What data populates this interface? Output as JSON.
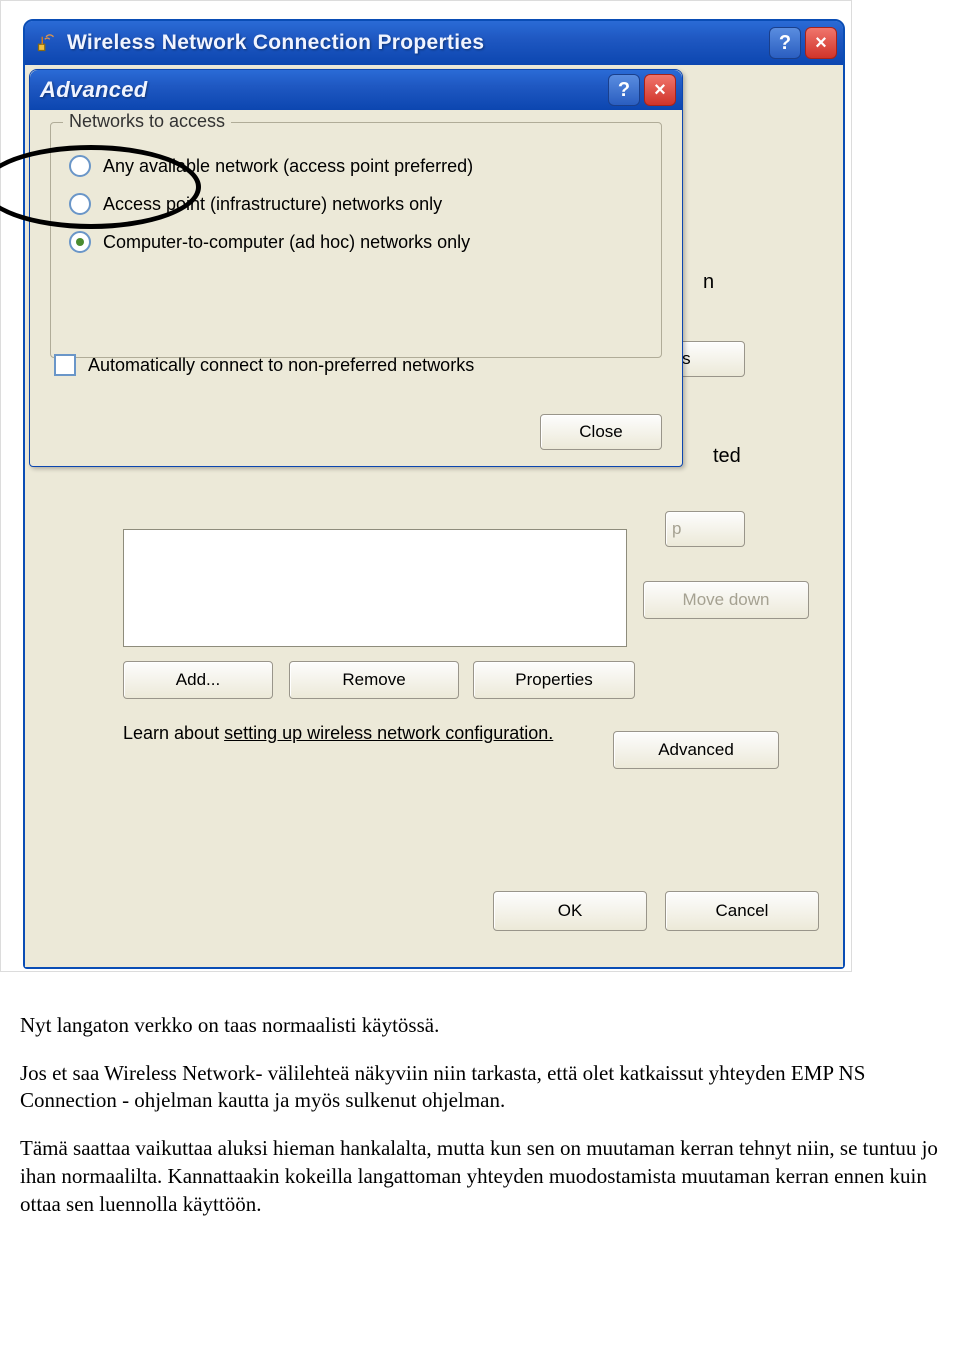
{
  "parent": {
    "title": "Wireless Network Connection Properties",
    "side_text1": "n",
    "side_btn_rks": "rks",
    "side_text_ted": "ted",
    "side_btn_p": "p",
    "move_down": "Move down",
    "add": "Add...",
    "remove": "Remove",
    "properties": "Properties",
    "learn_pre": "Learn about ",
    "learn_link": "setting up wireless network configuration.",
    "advanced": "Advanced",
    "ok": "OK",
    "cancel": "Cancel"
  },
  "child": {
    "title": "Advanced",
    "group_label": "Networks to access",
    "radio1": "Any available network (access point preferred)",
    "radio2": "Access point (infrastructure) networks only",
    "radio3": "Computer-to-computer (ad hoc) networks only",
    "selected_index": 2,
    "checkbox_label": "Automatically connect to non-preferred networks",
    "checkbox_checked": false,
    "close": "Close"
  },
  "icons": {
    "help": "?",
    "close": "×"
  },
  "doc": {
    "p1": "Nyt langaton verkko on taas normaalisti käytössä.",
    "p2": "Jos et saa Wireless Network- välilehteä näkyviin niin tarkasta, että olet katkaissut yhteyden EMP NS Connection - ohjelman kautta ja myös sulkenut ohjelman.",
    "p3": "Tämä saattaa vaikuttaa aluksi hieman hankalalta, mutta kun sen on muutaman kerran tehnyt niin, se tuntuu jo ihan normaalilta. Kannattaakin kokeilla langattoman yhteyden muodostamista muutaman kerran ennen kuin ottaa sen luennolla käyttöön."
  }
}
